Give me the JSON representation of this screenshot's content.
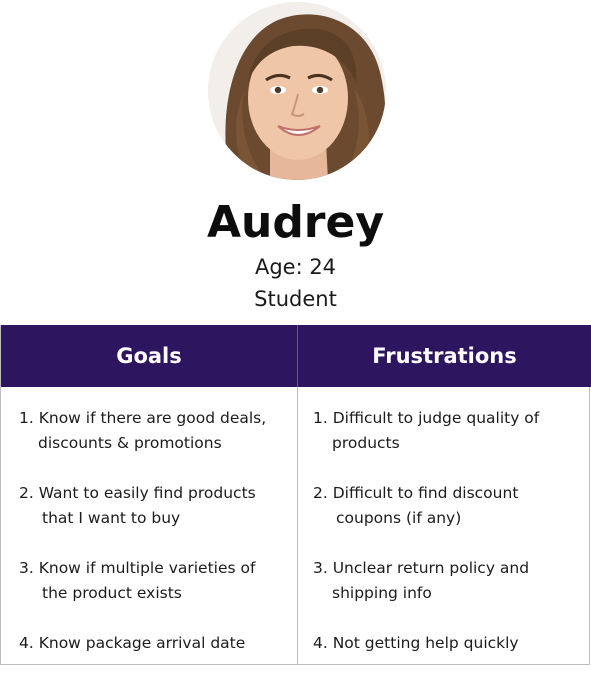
{
  "persona": {
    "name": "Audrey",
    "age_text": "Age: 24",
    "occupation": "Student"
  },
  "table": {
    "headers": {
      "goals": "Goals",
      "frustrations": "Frustrations"
    },
    "goals": [
      {
        "line1": "1. Know if there are good deals,",
        "line2": "discounts & promotions"
      },
      {
        "line1": "2. Want to easily find products",
        "line2": "that I want to buy"
      },
      {
        "line1": "3.  Know if multiple varieties of",
        "line2": "the product exists"
      },
      {
        "line1": "4. Know package arrival date"
      }
    ],
    "frustrations": [
      {
        "line1": "1. Difficult to judge quality of",
        "line2": "products"
      },
      {
        "line1": "2. Difficult to find discount",
        "line2": "coupons (if any)"
      },
      {
        "line1": "3. Unclear return policy and",
        "line2": "shipping info"
      },
      {
        "line1": "4. Not getting help quickly"
      }
    ]
  },
  "colors": {
    "header_bg": "#2e1560",
    "header_text": "#ffffff",
    "border": "#bdbdbd"
  }
}
